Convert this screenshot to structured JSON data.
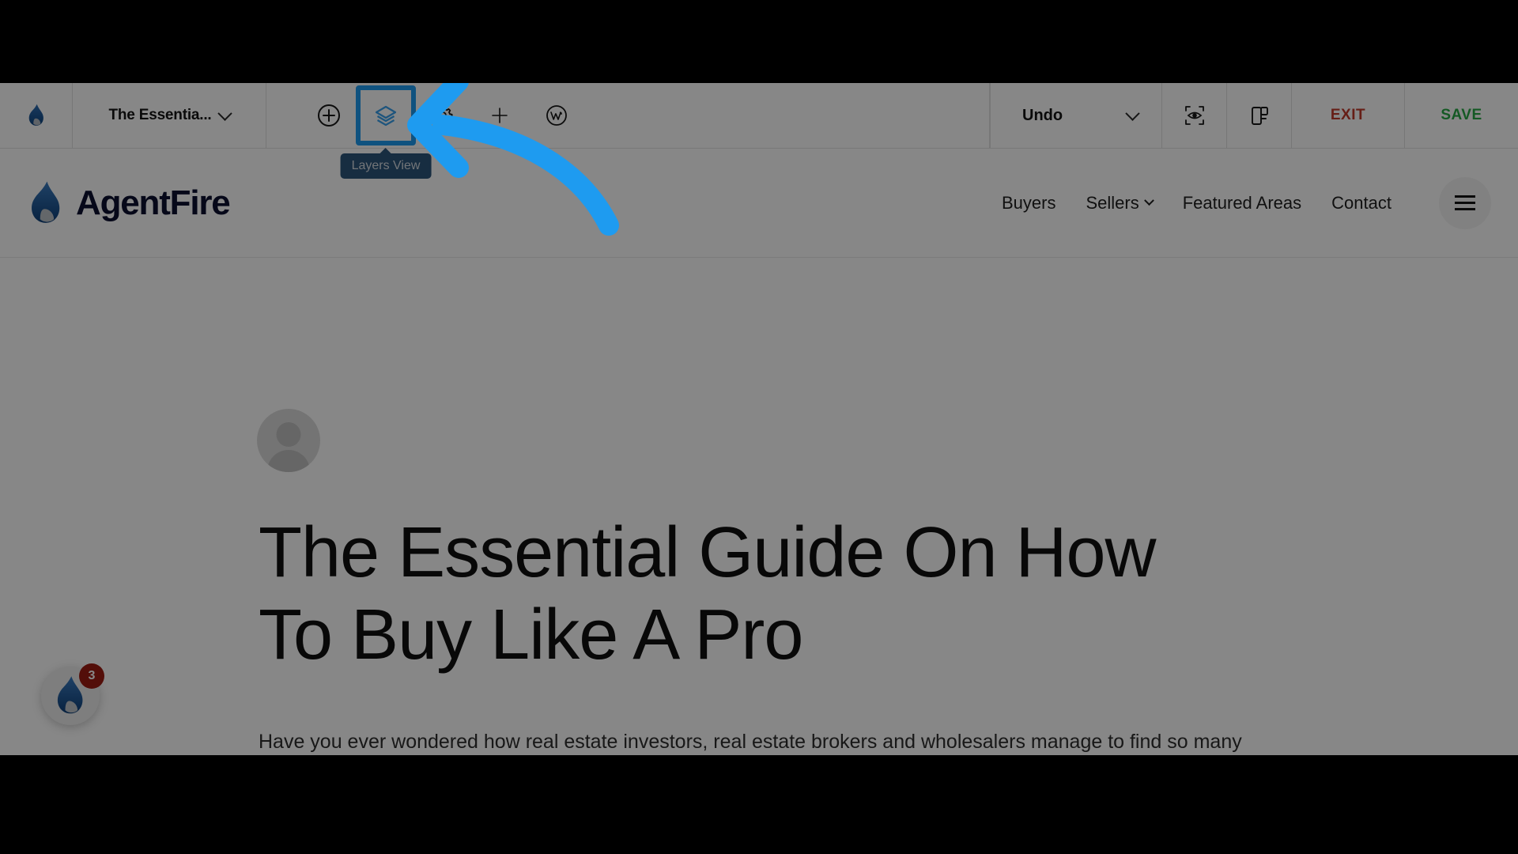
{
  "builder_toolbar": {
    "logo_icon": "agentfire-flame-icon",
    "page_title": "The Essentia...",
    "title_chevron_icon": "chevron-down-icon",
    "tools": [
      {
        "name": "add-element-button",
        "icon": "plus-circle-icon",
        "label": "Add"
      },
      {
        "name": "layers-view-button",
        "icon": "layers-icon",
        "label": "Layers View",
        "active": true
      },
      {
        "name": "settings-button",
        "icon": "gear-icon",
        "label": "Settings"
      },
      {
        "name": "navigator-button",
        "icon": "navigator-icon",
        "label": "Navigator"
      },
      {
        "name": "wordpress-button",
        "icon": "wordpress-icon",
        "label": "WordPress"
      }
    ],
    "tooltip": "Layers View",
    "undo_label": "Undo",
    "undo_chevron_icon": "chevron-down-icon",
    "preview_icon": "preview-eye-icon",
    "responsive_icon": "responsive-layout-icon",
    "exit_label": "EXIT",
    "save_label": "SAVE",
    "exit_color": "#c0392b",
    "save_color": "#27a844"
  },
  "site_header": {
    "brand_icon": "agentfire-flame-icon",
    "brand_name": "AgentFire",
    "nav": [
      {
        "label": "Buyers",
        "has_chevron": false
      },
      {
        "label": "Sellers",
        "has_chevron": true
      },
      {
        "label": "Featured Areas",
        "has_chevron": false
      },
      {
        "label": "Contact",
        "has_chevron": false
      }
    ],
    "menu_icon": "hamburger-menu-icon"
  },
  "article": {
    "avatar_icon": "user-avatar-placeholder-icon",
    "headline": "The Essential Guide On How To Buy Like A Pro",
    "lede": "Have you ever wondered how real estate investors, real estate brokers and wholesalers manage to find so many great deals on properties so consistently? It has nothing to do with luck or a sixth sense. They're able to do so because they know where to look and have the knowledge and savvy to upgrade a good deal into a"
  },
  "chat_widget": {
    "icon": "agentfire-flame-icon",
    "badge_count": "3",
    "badge_color": "#9e1b12"
  },
  "annotation": {
    "arrow_icon": "curved-left-arrow-annotation",
    "arrow_color": "#1e9bf0",
    "points_to": "layers-view-button"
  }
}
